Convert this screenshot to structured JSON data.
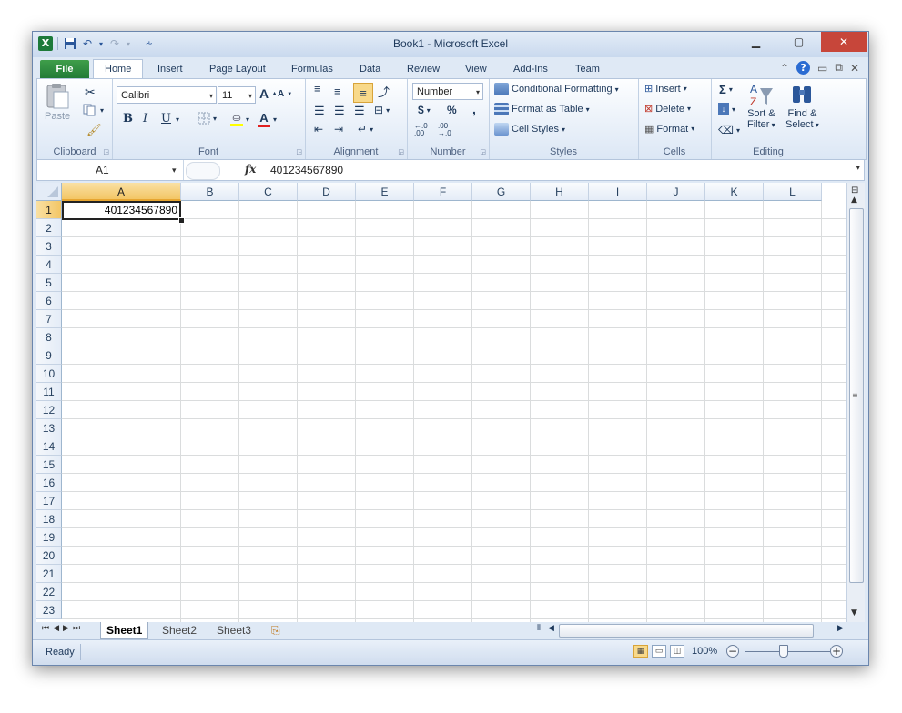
{
  "window": {
    "title": "Book1 - Microsoft Excel"
  },
  "quick_access": {
    "logo_letter": "X",
    "undo": "↶",
    "redo": "↷",
    "customize": "⩪"
  },
  "window_controls": {
    "minimize": "▁",
    "maximize": "▢",
    "close": "✕"
  },
  "ribbon_tabs": {
    "file": "File",
    "items": [
      "Home",
      "Insert",
      "Page Layout",
      "Formulas",
      "Data",
      "Review",
      "View",
      "Add-Ins",
      "Team"
    ]
  },
  "ribbon": {
    "clipboard": {
      "label": "Clipboard",
      "paste": "Paste"
    },
    "font": {
      "label": "Font",
      "name": "Calibri",
      "size": "11",
      "bold": "B",
      "italic": "I",
      "underline": "U",
      "grow": "A",
      "shrink": "A",
      "font_color_letter": "A"
    },
    "alignment": {
      "label": "Alignment"
    },
    "number": {
      "label": "Number",
      "format": "Number",
      "currency": "$",
      "percent": "%",
      "comma": ",",
      "inc_decimal": "←.0 .00",
      "dec_decimal": ".00 →.0"
    },
    "styles": {
      "label": "Styles",
      "conditional": "Conditional Formatting",
      "format_table": "Format as Table",
      "cell_styles": "Cell Styles"
    },
    "cells": {
      "label": "Cells",
      "insert": "Insert",
      "delete": "Delete",
      "format": "Format"
    },
    "editing": {
      "label": "Editing",
      "sigma": "Σ",
      "sort_filter_1": "Sort &",
      "sort_filter_2": "Filter",
      "find_select_1": "Find &",
      "find_select_2": "Select"
    }
  },
  "formula_bar": {
    "name_box": "A1",
    "fx": "fx",
    "content": "401234567890"
  },
  "columns": [
    "A",
    "B",
    "C",
    "D",
    "E",
    "F",
    "G",
    "H",
    "I",
    "J",
    "K",
    "L"
  ],
  "rows": [
    "1",
    "2",
    "3",
    "4",
    "5",
    "6",
    "7",
    "8",
    "9",
    "10",
    "11",
    "12",
    "13",
    "14",
    "15",
    "16",
    "17",
    "18",
    "19",
    "20",
    "21",
    "22",
    "23"
  ],
  "cells": {
    "A1": "401234567890"
  },
  "sheets": [
    "Sheet1",
    "Sheet2",
    "Sheet3"
  ],
  "status": {
    "mode": "Ready",
    "zoom": "100%"
  },
  "colors": {
    "file_tab": "#217a36",
    "selected_header": "#f3c665",
    "close": "#c7463a"
  }
}
